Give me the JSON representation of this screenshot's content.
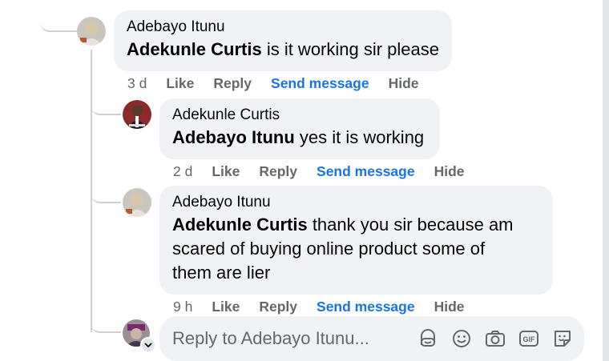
{
  "comments": [
    {
      "author": "Adebayo Itunu",
      "mention": "Adekunle Curtis",
      "text": " is it working sir please",
      "time": "3 d",
      "like": "Like",
      "reply": "Reply",
      "send_message": "Send message",
      "hide": "Hide"
    },
    {
      "author": "Adekunle Curtis",
      "mention": "Adebayo Itunu",
      "text": " yes it is working",
      "time": "2 d",
      "like": "Like",
      "reply": "Reply",
      "send_message": "Send message",
      "hide": "Hide"
    },
    {
      "author": "Adebayo Itunu",
      "mention": "Adekunle Curtis",
      "text_line1": " thank you sir because am",
      "text_line2": "scared of buying online product some of",
      "text_line3": "them are lier",
      "time": "9 h",
      "like": "Like",
      "reply": "Reply",
      "send_message": "Send message",
      "hide": "Hide"
    }
  ],
  "reply_box": {
    "placeholder": "Reply to Adebayo Itunu...",
    "tools": [
      "avatar-sticker-icon",
      "emoji-icon",
      "camera-icon",
      "gif-icon",
      "sticker-icon"
    ]
  },
  "colors": {
    "bubble": "#f0f2f5",
    "link_blue": "#1b74e4",
    "secondary_text": "#65676b",
    "thread_line": "#ced0d4"
  }
}
